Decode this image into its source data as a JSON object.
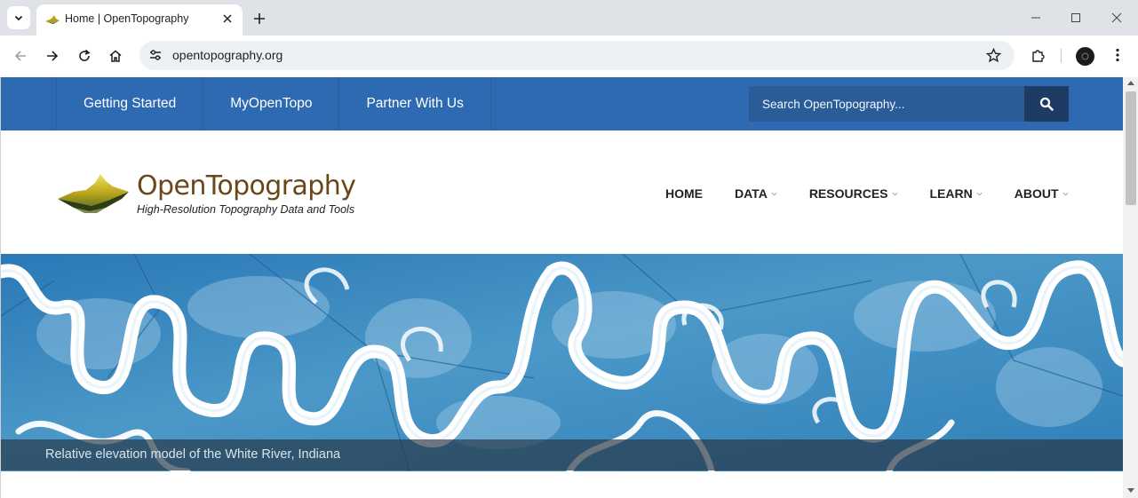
{
  "browser": {
    "tab_title": "Home | OpenTopography",
    "url": "opentopography.org"
  },
  "site": {
    "topnav": [
      {
        "label": "Getting Started"
      },
      {
        "label": "MyOpenTopo"
      },
      {
        "label": "Partner With Us"
      }
    ],
    "search_placeholder": "Search OpenTopography...",
    "logo_title": "OpenTopography",
    "logo_subtitle": "High-Resolution Topography Data and Tools",
    "mainnav": [
      {
        "label": "HOME",
        "has_dropdown": false
      },
      {
        "label": "DATA",
        "has_dropdown": true
      },
      {
        "label": "RESOURCES",
        "has_dropdown": true
      },
      {
        "label": "LEARN",
        "has_dropdown": true
      },
      {
        "label": "ABOUT",
        "has_dropdown": true
      }
    ],
    "hero_caption": "Relative elevation model of the White River, Indiana"
  },
  "colors": {
    "topbar": "#2d6ab2",
    "search_button": "#1d3b63",
    "logo_title": "#6a4719",
    "hero_blue": "#3f8cc0"
  }
}
